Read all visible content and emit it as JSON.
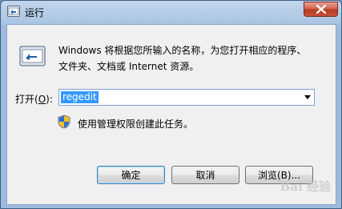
{
  "window": {
    "title": "运行"
  },
  "description": {
    "line1": "Windows 将根据您所输入的名称，为您打开相应的程序、",
    "line2": "文件夹、文档或 Internet 资源。"
  },
  "open_field": {
    "label_prefix": "打开(",
    "label_accel": "O",
    "label_suffix": "):",
    "value": "regedit"
  },
  "admin_note": "使用管理权限创建此任务。",
  "buttons": {
    "ok": "确定",
    "cancel": "取消",
    "browse": "浏览(B)..."
  },
  "watermark": "Bai 经验",
  "icons": {
    "app": "run-icon",
    "close": "close-icon",
    "dropdown": "chevron-down-icon",
    "shield": "uac-shield-icon"
  }
}
